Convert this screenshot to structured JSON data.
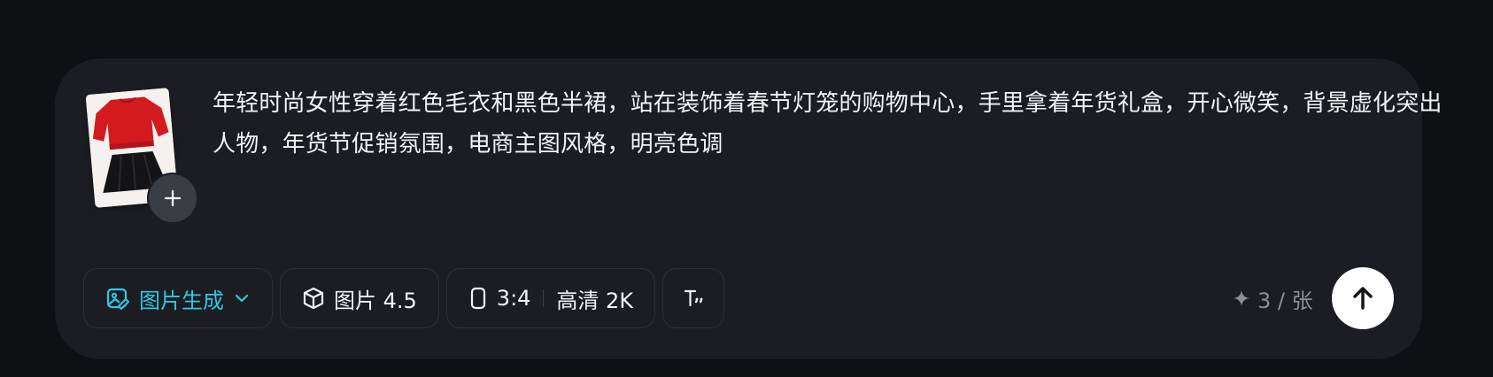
{
  "input": {
    "prompt_text": "年轻时尚女性穿着红色毛衣和黑色半裙，站在装饰着春节灯笼的购物中心，手里拿着年货礼盒，开心微笑，背景虚化突出人物，年货节促销氛围，电商主图风格，明亮色调",
    "attachment_icon": "clothing-thumbnail",
    "add_icon": "plus-icon"
  },
  "toolbar": {
    "mode_label": "图片生成",
    "mode_icon": "image-edit-icon",
    "model_label": "图片 4.5",
    "model_icon": "cube-icon",
    "ratio_label": "3:4",
    "ratio_icon": "portrait-rect-icon",
    "quality_label": "高清 2K",
    "text_style_icon": "text-style-icon"
  },
  "credits": {
    "label": "3 / 张",
    "icon": "sparkle-icon"
  },
  "send": {
    "icon": "arrow-up-icon"
  },
  "colors": {
    "background": "#0f1013",
    "card": "#1c1d22",
    "accent": "#2ec7e6",
    "text": "#f2f3f5",
    "muted": "#8b8f98"
  }
}
